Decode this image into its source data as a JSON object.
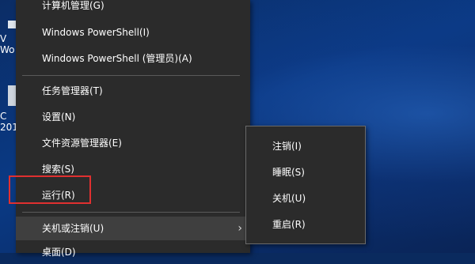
{
  "desktop": {
    "icons": [
      {
        "label": "V\nWo",
        "icon": "shortcut-icon"
      },
      {
        "label": "C\n201",
        "icon": "file-icon"
      }
    ]
  },
  "winx_menu": {
    "items": [
      {
        "label": "计算机管理(G)"
      },
      {
        "label": "Windows PowerShell(I)"
      },
      {
        "label": "Windows PowerShell (管理员)(A)"
      },
      {
        "label": "任务管理器(T)"
      },
      {
        "label": "设置(N)"
      },
      {
        "label": "文件资源管理器(E)"
      },
      {
        "label": "搜索(S)"
      },
      {
        "label": "运行(R)"
      },
      {
        "label": "关机或注销(U)",
        "has_submenu": true,
        "arrow": "›"
      },
      {
        "label": "桌面(D)"
      }
    ],
    "highlight_color": "#e03030"
  },
  "shutdown_submenu": {
    "items": [
      {
        "label": "注销(I)"
      },
      {
        "label": "睡眠(S)"
      },
      {
        "label": "关机(U)"
      },
      {
        "label": "重启(R)"
      }
    ]
  }
}
